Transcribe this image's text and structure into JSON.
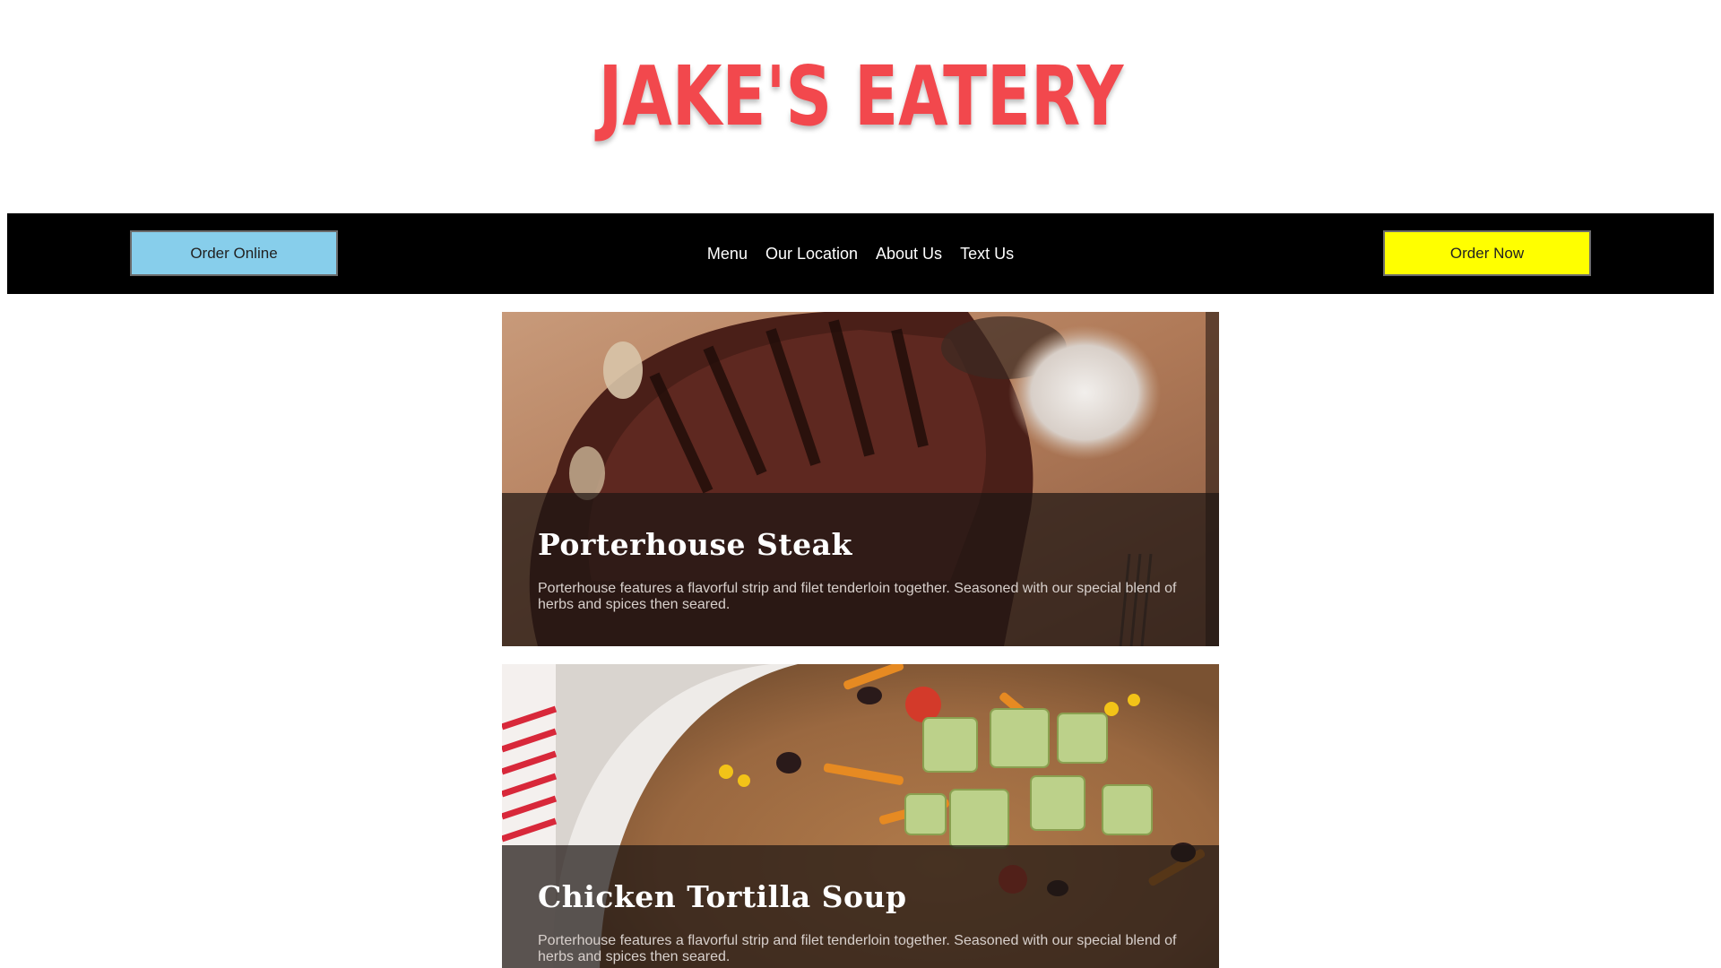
{
  "header": {
    "logo_text": "JAKE'S EATERY",
    "logo_color": "#f2484d"
  },
  "navbar": {
    "order_online_label": "Order Online",
    "order_online_color": "#87ceeb",
    "links": [
      "Menu",
      "Our Location",
      "About Us",
      "Text Us"
    ],
    "order_now_label": "Order Now",
    "order_now_color": "#ffff00"
  },
  "menu_items": [
    {
      "title": "Porterhouse Steak",
      "description": "Porterhouse features a flavorful strip and filet tenderloin together. Seasoned with our special blend of herbs and spices then seared."
    },
    {
      "title": "Chicken Tortilla Soup",
      "description": "Porterhouse features a flavorful strip and filet tenderloin together. Seasoned with our special blend of herbs and spices then seared."
    }
  ]
}
